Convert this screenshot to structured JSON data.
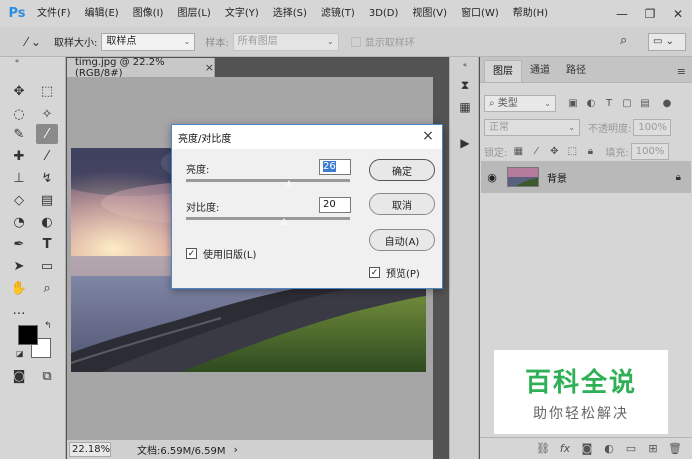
{
  "app": {
    "logo": "Ps",
    "menu": [
      "文件(F)",
      "编辑(E)",
      "图像(I)",
      "图层(L)",
      "文字(Y)",
      "选择(S)",
      "滤镜(T)",
      "3D(D)",
      "视图(V)",
      "窗口(W)",
      "帮助(H)"
    ]
  },
  "options": {
    "sample_size_label": "取样大小:",
    "sample_size_value": "取样点",
    "sample_label": "样本:",
    "sample_value": "所有图层",
    "show_ring_label": "显示取样环"
  },
  "document": {
    "tab_title": "timg.jpg @ 22.2%(RGB/8#)",
    "zoom": "22.18%",
    "doc_info": "文档:6.59M/6.59M"
  },
  "layers_panel": {
    "tabs": [
      "图层",
      "通道",
      "路径"
    ],
    "filter_kind": "类型",
    "blend_mode": "正常",
    "opacity_label": "不透明度:",
    "opacity_value": "100%",
    "lock_label": "锁定:",
    "fill_label": "填充:",
    "fill_value": "100%",
    "layer_name": "背景"
  },
  "dialog": {
    "title": "亮度/对比度",
    "brightness_label": "亮度:",
    "brightness_value": "26",
    "contrast_label": "对比度:",
    "contrast_value": "20",
    "ok_label": "确定",
    "cancel_label": "取消",
    "auto_label": "自动(A)",
    "legacy_label": "使用旧版(L)",
    "legacy_checked": true,
    "preview_label": "预览(P)",
    "preview_checked": true
  },
  "watermark": {
    "title": "百科全说",
    "subtitle": "助你轻松解决"
  }
}
